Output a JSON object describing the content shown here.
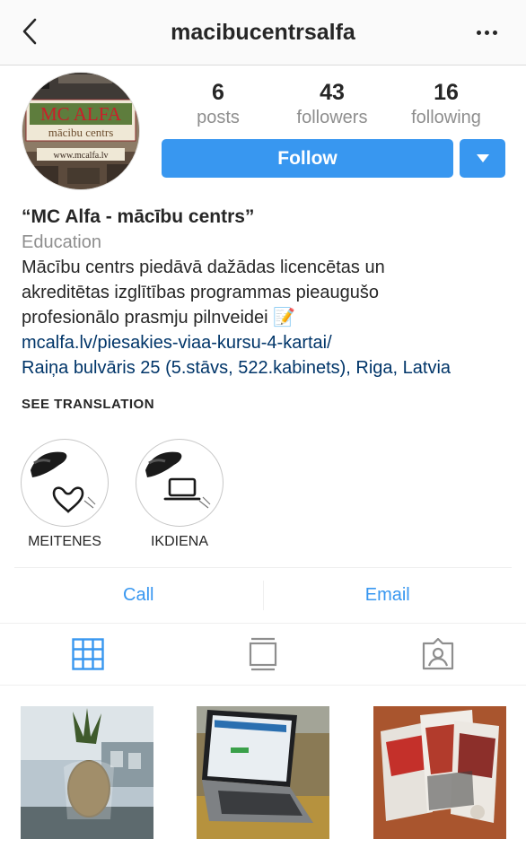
{
  "header": {
    "username": "macibucentrsalfa",
    "back_icon": "chevron-left-icon",
    "more_icon": "more-horizontal-icon"
  },
  "profile": {
    "avatar_text": {
      "line1": "MC ALFA",
      "line2": "mācibu centrs",
      "line3": "www.mcalfa.lv"
    },
    "stats": [
      {
        "value": "6",
        "label": "posts"
      },
      {
        "value": "43",
        "label": "followers"
      },
      {
        "value": "16",
        "label": "following"
      }
    ],
    "follow_label": "Follow",
    "dropdown_icon": "caret-down-icon",
    "accent_color": "#3897f0"
  },
  "bio": {
    "name": "“MC Alfa - mācību centrs”",
    "category": "Education",
    "lines": [
      "Mācību centrs piedāvā dažādas licencētas un",
      "akreditētas izglītības programmas pieaugušo",
      "profesionālo prasmju pilnveidei"
    ],
    "emoji": "📝",
    "website": "mcalfa.lv/piesakies-viaa-kursu-4-kartai/",
    "address": "Raiņa bulvāris 25 (5.stāvs, 522.kabinets), Riga, Latvia",
    "link_color": "#003569"
  },
  "see_translation": "SEE TRANSLATION",
  "highlights": [
    {
      "label": "MEITENES",
      "icon": "heart-icon"
    },
    {
      "label": "IKDIENA",
      "icon": "laptop-icon"
    }
  ],
  "actions": {
    "call": "Call",
    "email": "Email"
  },
  "tabs": [
    {
      "name": "grid",
      "icon": "grid-icon",
      "active": true
    },
    {
      "name": "feed",
      "icon": "feed-icon",
      "active": false
    },
    {
      "name": "tagged",
      "icon": "tagged-icon",
      "active": false
    }
  ],
  "posts": [
    {
      "icon": "photo-pineapple"
    },
    {
      "icon": "photo-laptop"
    },
    {
      "icon": "photo-books"
    }
  ]
}
